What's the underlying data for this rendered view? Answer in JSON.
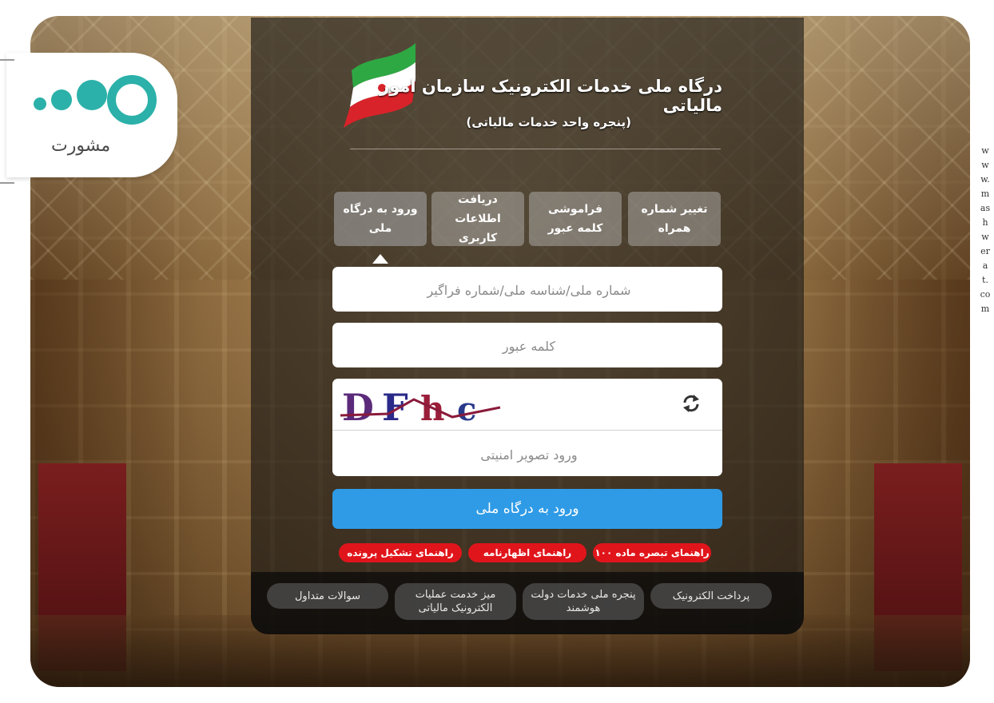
{
  "header": {
    "title": "درگاه ملی خدمات الکترونیک سازمان امور مالیاتی",
    "subtitle": "(پنجره واحد خدمات مالیاتی)"
  },
  "tabs": [
    {
      "label": "ورود به درگاه ملی",
      "active": true
    },
    {
      "label": "دریافت اطلاعات کاربری",
      "active": false
    },
    {
      "label": "فراموشی کلمه عبور",
      "active": false
    },
    {
      "label": "تغییر شماره همراه",
      "active": false
    }
  ],
  "form": {
    "national_id_placeholder": "شماره ملی/شناسه ملی/شماره فراگیر",
    "password_placeholder": "کلمه عبور",
    "captcha_text": "DFhc",
    "captcha_placeholder": "ورود تصویر امنیتی",
    "submit_label": "ورود به درگاه ملی"
  },
  "guides": [
    "راهنمای تبصره ماده ۱۰۰",
    "راهنمای اظهارنامه",
    "راهنمای تشکیل پرونده"
  ],
  "footer_links": [
    "پرداخت الکترونیک",
    "پنجره ملی خدمات دولت هوشمند",
    "میز خدمت عملیات الکترونیک مالیاتی",
    "سوالات متداول"
  ],
  "watermark": {
    "brand": "مشورت",
    "site": "www.mashwerat.com"
  },
  "colors": {
    "accent": "#2f9be6",
    "guide_red": "#e0151b",
    "logo_teal": "#2bb1a9"
  },
  "icons": {
    "refresh": "refresh-icon",
    "flag": "iran-flag-icon"
  }
}
